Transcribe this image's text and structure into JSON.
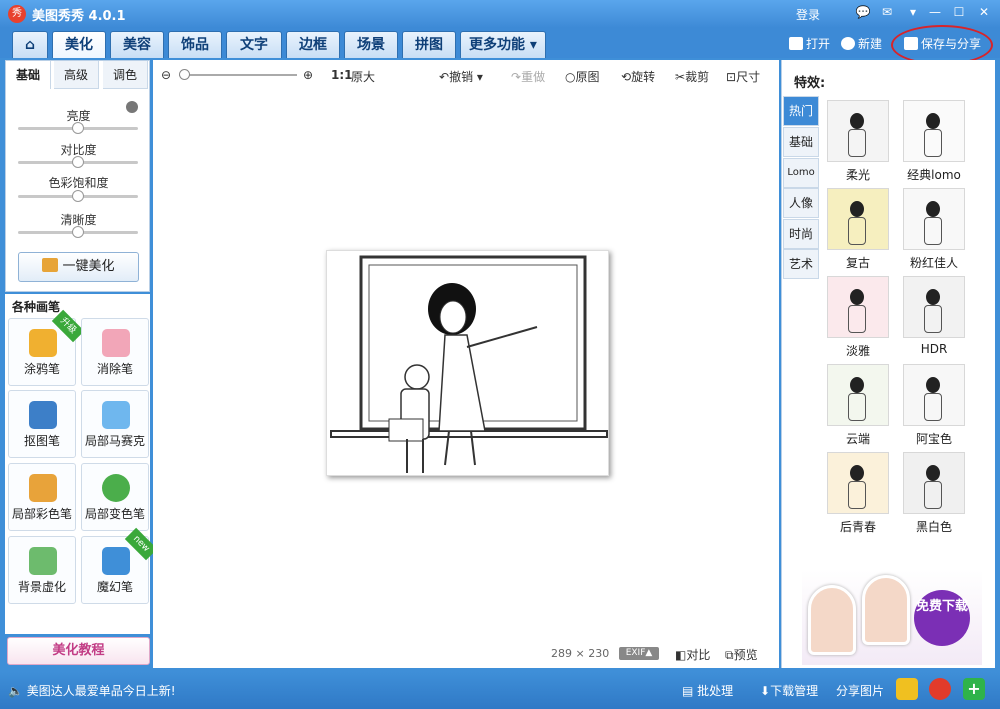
{
  "app": {
    "title": "美图秀秀 4.0.1",
    "logo_char": "秀",
    "login": "登录"
  },
  "window_buttons": {
    "chat": "💬",
    "skin": "✉",
    "menu": "▾",
    "minimize": "—",
    "maximize": "☐",
    "close": "✕"
  },
  "nav_tabs": [
    {
      "label": "⌂"
    },
    {
      "label": "美化"
    },
    {
      "label": "美容"
    },
    {
      "label": "饰品"
    },
    {
      "label": "文字"
    },
    {
      "label": "边框"
    },
    {
      "label": "场景"
    },
    {
      "label": "拼图"
    },
    {
      "label": "更多功能 ▾"
    }
  ],
  "top_actions": {
    "open": "打开",
    "new": "新建",
    "save_share": "保存与分享"
  },
  "left": {
    "sub_tabs": [
      "基础",
      "高级",
      "调色"
    ],
    "sliders": [
      {
        "label": "亮度",
        "value": 0.5
      },
      {
        "label": "对比度",
        "value": 0.5
      },
      {
        "label": "色彩饱和度",
        "value": 0.5
      },
      {
        "label": "清晰度",
        "value": 0.5
      }
    ],
    "one_key": "一键美化",
    "tools_header": "各种画笔",
    "tools": [
      {
        "label": "涂鸦笔",
        "badge": "升级",
        "color": "#f0b030"
      },
      {
        "label": "消除笔",
        "badge": "",
        "color": "#f2a6b8"
      },
      {
        "label": "抠图笔",
        "badge": "",
        "color": "#3d7fc8"
      },
      {
        "label": "局部马赛克",
        "badge": "",
        "color": "#6fb7ee"
      },
      {
        "label": "局部彩色笔",
        "badge": "",
        "color": "#e8a33a"
      },
      {
        "label": "局部变色笔",
        "badge": "",
        "color": "#4bae4b"
      },
      {
        "label": "背景虚化",
        "badge": "",
        "color": "#6dbb6d"
      },
      {
        "label": "魔幻笔",
        "badge": "new",
        "color": "#3f8fd8"
      }
    ],
    "tutorial": "美化教程"
  },
  "canvas_toolbar": {
    "zoom_ratio": "1:1",
    "original_size": "原大",
    "undo": "撤销",
    "redo": "重做",
    "original": "原图",
    "rotate": "旋转",
    "crop": "裁剪",
    "resize": "尺寸"
  },
  "canvas": {
    "width": "289",
    "times": "×",
    "height": "230",
    "exif": "EXIF▲",
    "compare": "对比",
    "preview": "预览"
  },
  "right": {
    "header": "特效:",
    "categories": [
      "热门",
      "基础",
      "Lomo",
      "人像",
      "时尚",
      "艺术"
    ],
    "effects": [
      {
        "label": "柔光",
        "tint": "#f4f4f4"
      },
      {
        "label": "经典lomo",
        "tint": "#fafafa"
      },
      {
        "label": "复古",
        "tint": "#f6efbf"
      },
      {
        "label": "粉红佳人",
        "tint": "#f8f8f8"
      },
      {
        "label": "淡雅",
        "tint": "#fbe9ec"
      },
      {
        "label": "HDR",
        "tint": "#f2f2f2"
      },
      {
        "label": "云端",
        "tint": "#f3f7ee"
      },
      {
        "label": "阿宝色",
        "tint": "#f7f7f7"
      },
      {
        "label": "后青春",
        "tint": "#fbf1da"
      },
      {
        "label": "黑白色",
        "tint": "#f0f0f0"
      }
    ],
    "ad_button": "免费下载"
  },
  "status": {
    "message": "美图达人最爱单品今日上新!",
    "batch": "批处理",
    "download_mgr": "下载管理",
    "share": "分享图片"
  }
}
